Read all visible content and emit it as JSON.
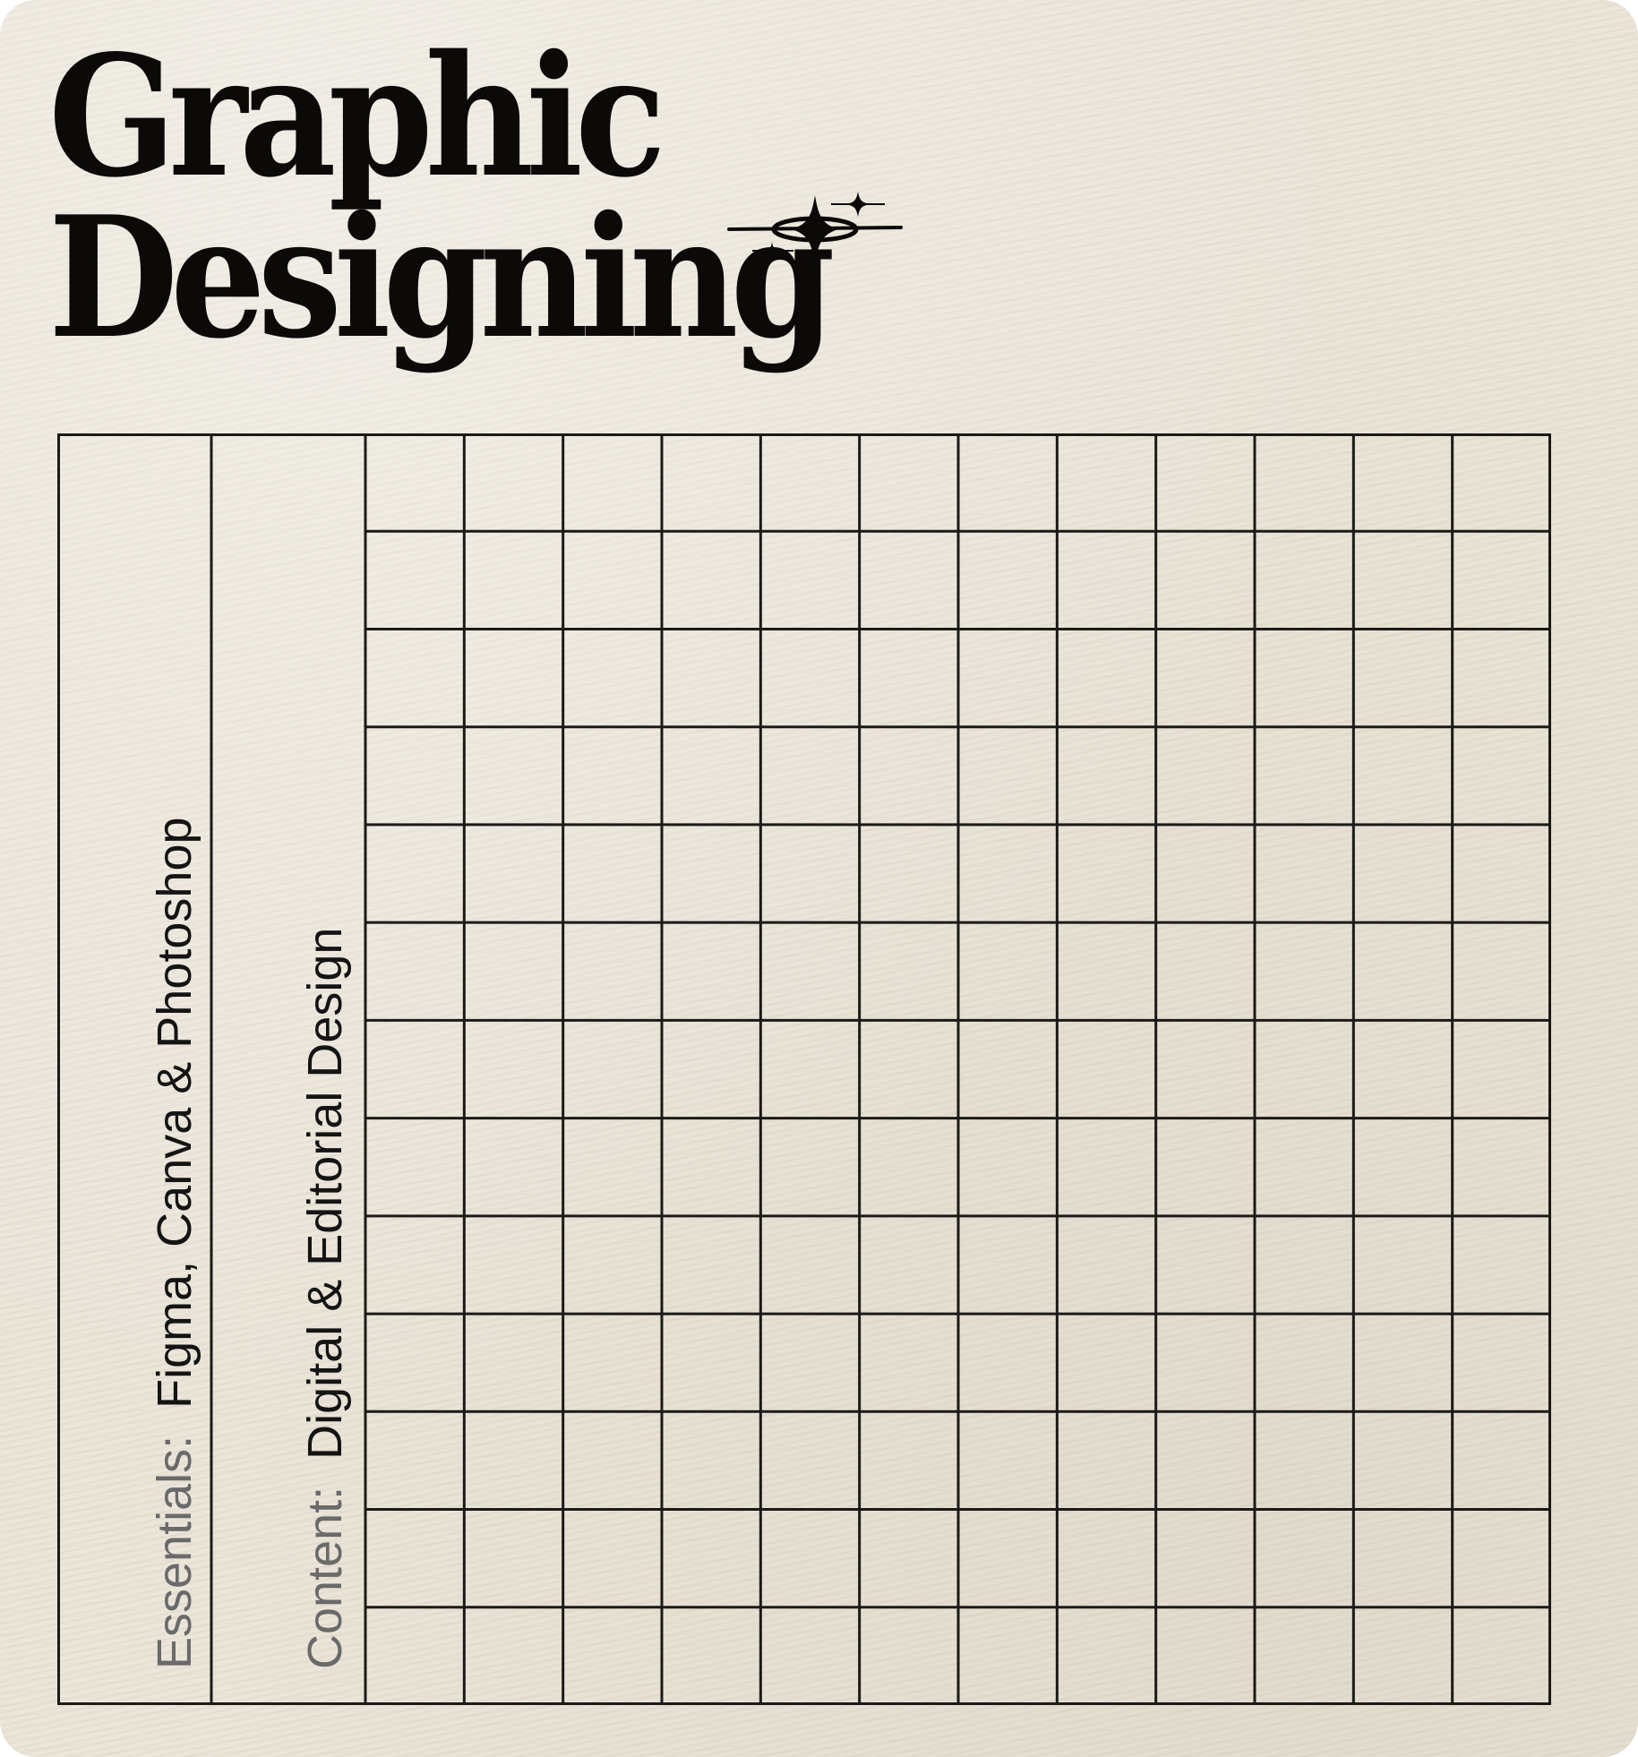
{
  "title": {
    "line1": "Graphic",
    "line2": "Designing"
  },
  "columns": [
    {
      "label": "Essentials:",
      "value": "Figma, Canva & Photoshop"
    },
    {
      "label": "Content:",
      "value": "Digital & Editorial Design"
    }
  ],
  "grid": {
    "columns": 12,
    "rows": 13
  },
  "icons": [
    "sparkle-orbit-icon"
  ],
  "colors": {
    "background": "#ebe5d9",
    "ink": "#0b0a08",
    "label_gray": "#6a6a6a"
  }
}
